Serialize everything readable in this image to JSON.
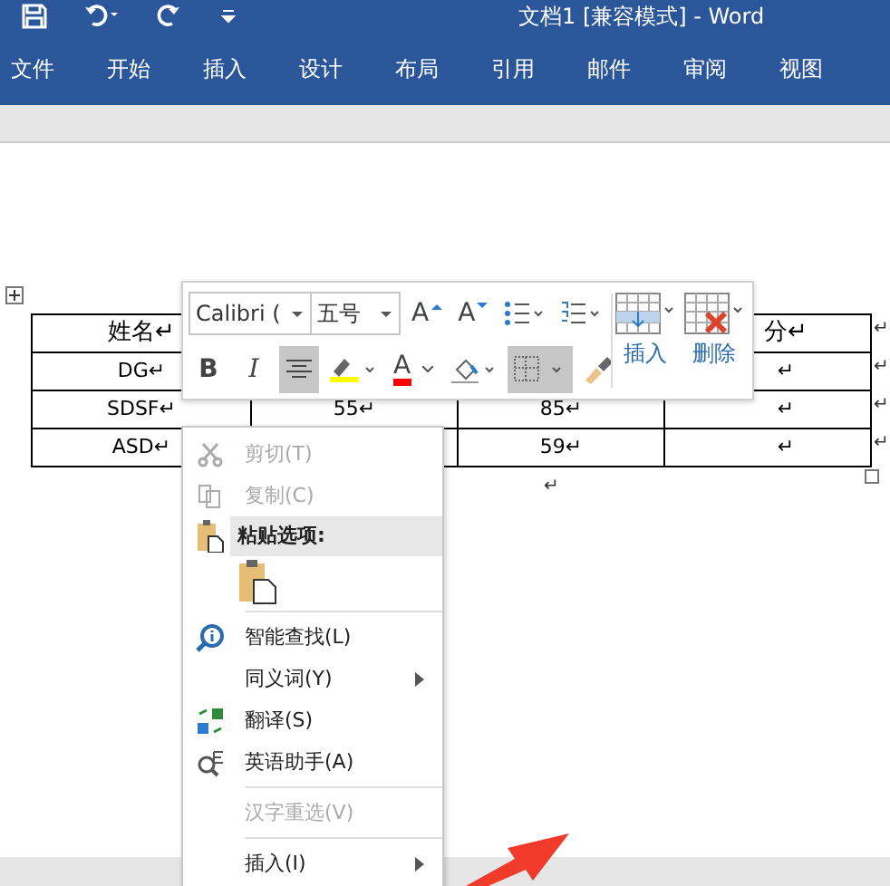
{
  "window": {
    "title": "文档1 [兼容模式]  -  Word"
  },
  "ribbon_tabs": [
    {
      "label": "文件"
    },
    {
      "label": "开始"
    },
    {
      "label": "插入"
    },
    {
      "label": "设计"
    },
    {
      "label": "布局"
    },
    {
      "label": "引用"
    },
    {
      "label": "邮件"
    },
    {
      "label": "审阅"
    },
    {
      "label": "视图"
    }
  ],
  "table": {
    "rows": [
      {
        "cells": [
          "姓名↵",
          null,
          null,
          "分↵"
        ],
        "end_mark": "↵"
      },
      {
        "cells": [
          "DG↵",
          null,
          null,
          "↵"
        ],
        "end_mark": "↵"
      },
      {
        "cells": [
          "SDSF↵",
          "55↵",
          "85↵",
          "↵"
        ],
        "end_mark": "↵"
      },
      {
        "cells": [
          "ASD↵",
          null,
          "59↵",
          "↵"
        ],
        "end_mark": "↵"
      }
    ]
  },
  "after_table_mark": "↵",
  "mini_toolbar": {
    "font": "Calibri (",
    "size": "五号",
    "buttons": [
      {
        "kind": "grow",
        "label": "A",
        "selected": false
      },
      {
        "kind": "shrink",
        "label": "A",
        "selected": false
      },
      {
        "kind": "bullets",
        "selected": false
      },
      {
        "kind": "numbering",
        "selected": false
      },
      {
        "kind": "bold",
        "label": "B",
        "selected": false
      },
      {
        "kind": "italic",
        "label": "I",
        "selected": false
      },
      {
        "kind": "center",
        "selected": true
      },
      {
        "kind": "highlight",
        "color": "#ffff00",
        "selected": false
      },
      {
        "kind": "font_color",
        "label": "A",
        "color": "#ff0000",
        "selected": false
      },
      {
        "kind": "shading",
        "selected": false
      },
      {
        "kind": "borders",
        "selected": true
      },
      {
        "kind": "painter",
        "selected": false
      }
    ],
    "insert": "插入",
    "delete": "删除"
  },
  "context_menu": [
    {
      "kind": "item",
      "label": "剪切(T)",
      "disabled": true,
      "highlighted": false,
      "submenu": false
    },
    {
      "kind": "item",
      "label": "复制(C)",
      "disabled": true,
      "highlighted": false,
      "submenu": false
    },
    {
      "kind": "header",
      "label": "粘贴选项:",
      "disabled": false,
      "highlighted": true,
      "submenu": false
    },
    {
      "kind": "paste",
      "highlighted": false
    },
    {
      "kind": "separator"
    },
    {
      "kind": "item",
      "label": "智能查找(L)",
      "disabled": false,
      "highlighted": false,
      "submenu": false
    },
    {
      "kind": "item",
      "label": "同义词(Y)",
      "disabled": false,
      "highlighted": false,
      "submenu": true
    },
    {
      "kind": "item",
      "label": "翻译(S)",
      "disabled": false,
      "highlighted": false,
      "submenu": false
    },
    {
      "kind": "item",
      "label": "英语助手(A)",
      "disabled": false,
      "highlighted": false,
      "submenu": false
    },
    {
      "kind": "separator"
    },
    {
      "kind": "item",
      "label": "汉字重选(V)",
      "disabled": true,
      "highlighted": false,
      "submenu": false
    },
    {
      "kind": "separator"
    },
    {
      "kind": "item",
      "label": "插入(I)",
      "disabled": false,
      "highlighted": false,
      "submenu": true
    }
  ]
}
